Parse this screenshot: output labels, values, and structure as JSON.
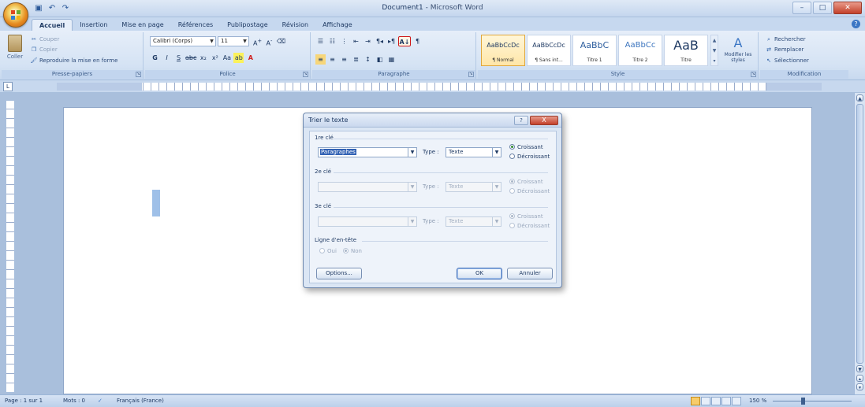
{
  "window": {
    "document_name": "Document1",
    "app_name": "Microsoft Word",
    "separator": " - "
  },
  "quick_access": [
    "save-icon",
    "undo-icon",
    "redo-icon"
  ],
  "tabs": [
    {
      "label": "Accueil",
      "active": true
    },
    {
      "label": "Insertion"
    },
    {
      "label": "Mise en page"
    },
    {
      "label": "Références"
    },
    {
      "label": "Publipostage"
    },
    {
      "label": "Révision"
    },
    {
      "label": "Affichage"
    }
  ],
  "ribbon": {
    "clipboard": {
      "label": "Presse-papiers",
      "paste": "Coller",
      "cut": "Couper",
      "copy": "Copier",
      "format_painter": "Reproduire la mise en forme"
    },
    "font": {
      "label": "Police",
      "font_name": "Calibri (Corps)",
      "font_size": "11"
    },
    "paragraph": {
      "label": "Paragraphe"
    },
    "styles": {
      "label": "Style",
      "tiles": [
        {
          "sample": "AaBbCcDc",
          "name": "¶ Normal",
          "active": true
        },
        {
          "sample": "AaBbCcDc",
          "name": "¶ Sans int..."
        },
        {
          "sample": "AaBbC",
          "name": "Titre 1"
        },
        {
          "sample": "AaBbCc",
          "name": "Titre 2"
        },
        {
          "sample": "AaB",
          "name": "Titre"
        }
      ],
      "change_styles": "Modifier les styles"
    },
    "editing": {
      "label": "Modification",
      "find": "Rechercher",
      "replace": "Remplacer",
      "select": "Sélectionner"
    }
  },
  "dialog": {
    "title": "Trier le texte",
    "help": "?",
    "close": "X",
    "key1": {
      "label": "1re clé",
      "value": "Paragraphes",
      "type_label": "Type :",
      "type_value": "Texte",
      "asc": "Croissant",
      "desc": "Décroissant",
      "selected": "asc"
    },
    "key2": {
      "label": "2e clé",
      "value": "",
      "type_label": "Type :",
      "type_value": "Texte",
      "asc": "Croissant",
      "desc": "Décroissant",
      "selected": "asc"
    },
    "key3": {
      "label": "3e clé",
      "value": "",
      "type_label": "Type :",
      "type_value": "Texte",
      "asc": "Croissant",
      "desc": "Décroissant",
      "selected": "asc"
    },
    "header_row": {
      "label": "Ligne d'en-tête",
      "yes": "Oui",
      "no": "Non",
      "selected": "no"
    },
    "options_button": "Options...",
    "ok_button": "OK",
    "cancel_button": "Annuler"
  },
  "statusbar": {
    "page": "Page : 1 sur 1",
    "words": "Mots : 0",
    "language": "Français (France)",
    "zoom": "150 %"
  },
  "colors": {
    "accent": "#3262b4",
    "sort_highlight": "#d01818",
    "close_red": "#c3402a"
  }
}
